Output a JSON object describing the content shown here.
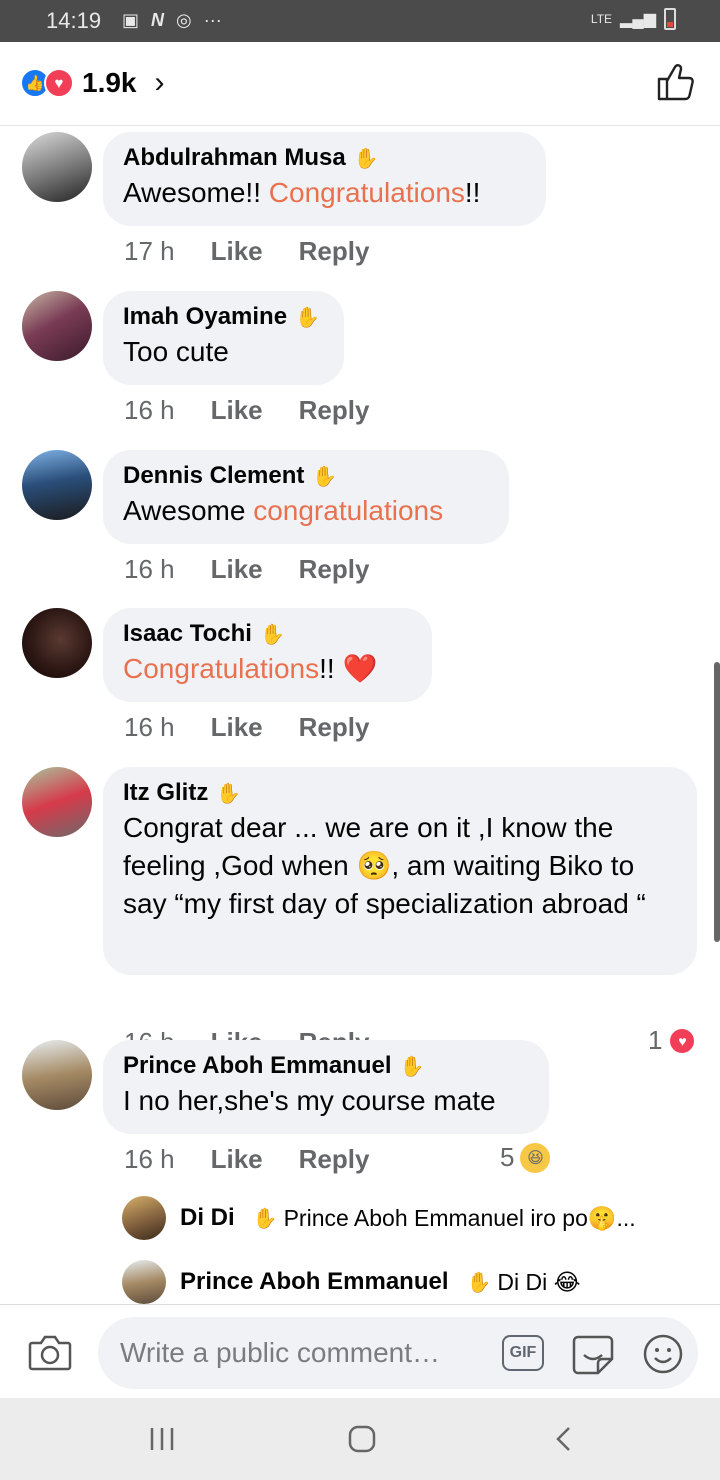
{
  "status_bar": {
    "time": "14:19",
    "network": "LTE",
    "more": "···"
  },
  "header": {
    "reaction_count": "1.9k"
  },
  "comments": [
    {
      "author": "Abdulrahman Musa",
      "text_plain": "Awesome!! ",
      "text_highlight": "Congratulations",
      "text_after": "!!",
      "time": "17 h",
      "like": "Like",
      "reply": "Reply"
    },
    {
      "author": "Imah Oyamine",
      "text_plain": "Too cute",
      "time": "16 h",
      "like": "Like",
      "reply": "Reply"
    },
    {
      "author": "Dennis Clement",
      "text_plain": "Awesome ",
      "text_highlight": "congratulations",
      "time": "16 h",
      "like": "Like",
      "reply": "Reply"
    },
    {
      "author": "Isaac Tochi",
      "text_highlight": "Congratulations",
      "text_after": "!! ",
      "emoji": "❤️",
      "time": "16 h",
      "like": "Like",
      "reply": "Reply"
    },
    {
      "author": "Itz Glitz",
      "text_part1": "Congrat dear ... we are on it ,I know the feeling ,God when ",
      "emoji": "🥺",
      "text_part2": ", am waiting Biko to say “my first day of specialization abroad “",
      "time": "16 h",
      "like": "Like",
      "reply": "Reply",
      "reaction_count": "1"
    },
    {
      "author": "Prince Aboh Emmanuel",
      "text_plain": "I no her,she's my course mate",
      "time": "16 h",
      "like": "Like",
      "reply": "Reply",
      "reaction_count": "5"
    }
  ],
  "replies": [
    {
      "author": "Di Di",
      "text": "Prince Aboh Emmanuel iro po🤫..."
    },
    {
      "author": "Prince Aboh Emmanuel",
      "text": "Di Di 😂"
    }
  ],
  "composer": {
    "placeholder": "Write a public comment…",
    "gif_label": "GIF"
  },
  "colors": {
    "highlight": "#e9714f",
    "like_blue": "#1877f2",
    "love_red": "#f33e58",
    "bubble": "#f0f2f5"
  },
  "icons": [
    "image-icon",
    "netflix-icon",
    "instagram-icon",
    "signal-icon",
    "battery-icon",
    "thumbs-up-icon",
    "wave-badge-icon",
    "camera-icon",
    "gif-icon",
    "sticker-icon",
    "emoji-icon",
    "recents-icon",
    "home-icon",
    "back-icon"
  ]
}
